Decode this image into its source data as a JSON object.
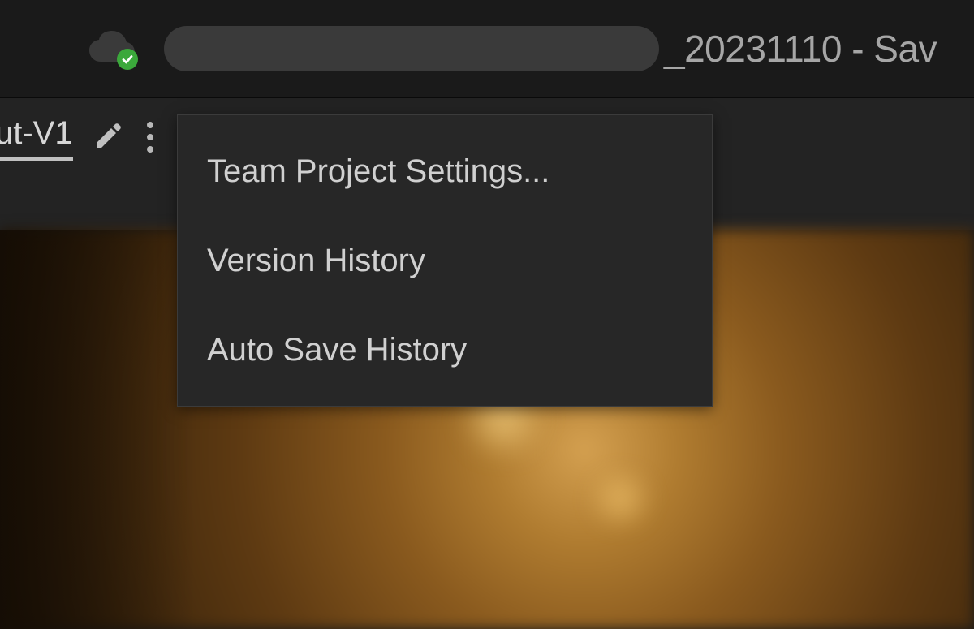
{
  "header": {
    "project_suffix": "_20231110 - Sav",
    "cloud_synced": true
  },
  "tab": {
    "label_fragment": "ut-V1"
  },
  "context_menu": {
    "items": [
      {
        "label": "Team Project Settings..."
      },
      {
        "label": "Version History"
      },
      {
        "label": "Auto Save History"
      }
    ]
  }
}
